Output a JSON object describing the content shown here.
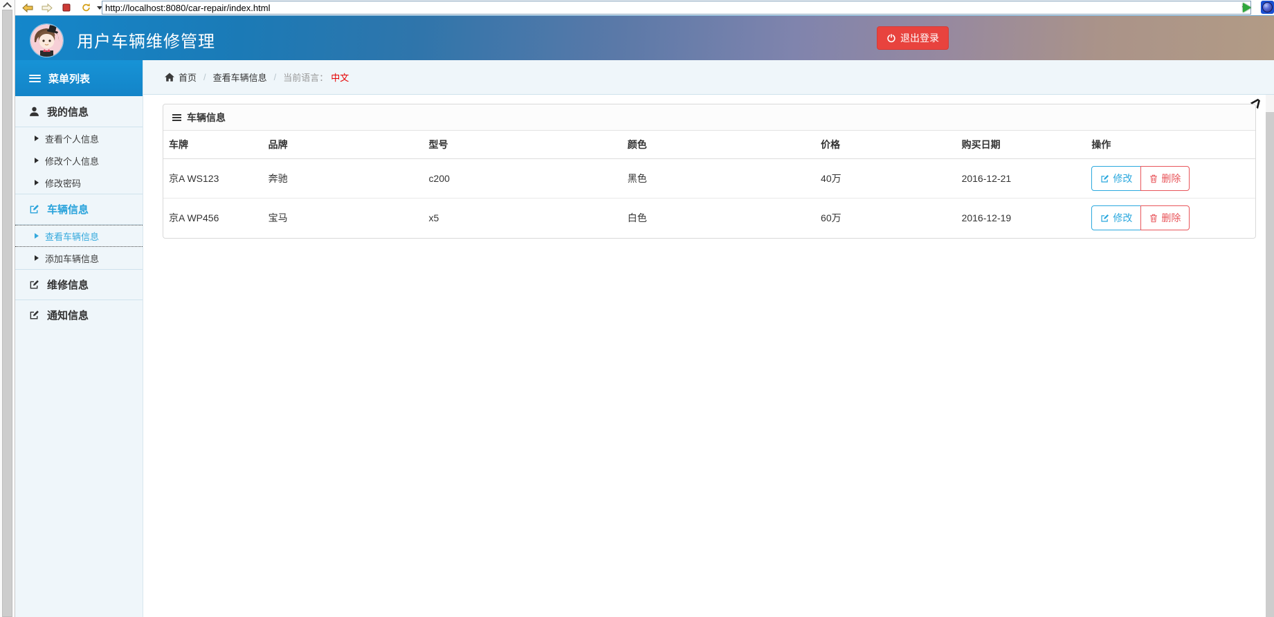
{
  "browser": {
    "url": "http://localhost:8080/car-repair/index.html"
  },
  "header": {
    "title": "用户车辆维修管理",
    "logout_label": "退出登录"
  },
  "sidebar": {
    "header_label": "菜单列表",
    "sections": [
      {
        "label": "我的信息",
        "children": [
          "查看个人信息",
          "修改个人信息",
          "修改密码"
        ]
      },
      {
        "label": "车辆信息",
        "children": [
          "查看车辆信息",
          "添加车辆信息"
        ]
      },
      {
        "label": "维修信息",
        "children": []
      },
      {
        "label": "通知信息",
        "children": []
      }
    ]
  },
  "breadcrumb": {
    "home": "首页",
    "current": "查看车辆信息",
    "lang_label": "当前语言：",
    "lang_value": "中文"
  },
  "panel": {
    "title": "车辆信息"
  },
  "table": {
    "columns": [
      "车牌",
      "品牌",
      "型号",
      "颜色",
      "价格",
      "购买日期",
      "操作"
    ],
    "rows": [
      {
        "plate": "京A WS123",
        "brand": "奔驰",
        "model": "c200",
        "color": "黑色",
        "price": "40万",
        "date": "2016-12-21"
      },
      {
        "plate": "京A WP456",
        "brand": "宝马",
        "model": "x5",
        "color": "白色",
        "price": "60万",
        "date": "2016-12-19"
      }
    ],
    "edit_label": "修改",
    "delete_label": "删除"
  },
  "colors": {
    "header_blue": "#1489ce",
    "logout_red": "#e8433e",
    "link_blue": "#2aa8de",
    "danger_red": "#e8555a",
    "lang_red": "#e60000"
  }
}
